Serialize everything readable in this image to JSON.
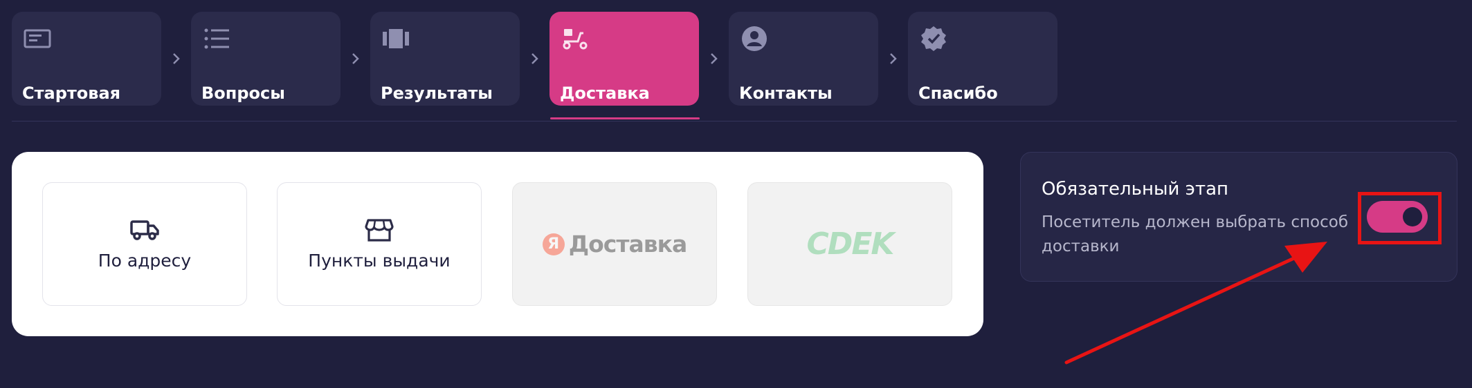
{
  "steps": [
    {
      "label": "Стартовая",
      "icon": "card-icon",
      "active": false
    },
    {
      "label": "Вопросы",
      "icon": "list-icon",
      "active": false
    },
    {
      "label": "Результаты",
      "icon": "slides-icon",
      "active": false
    },
    {
      "label": "Доставка",
      "icon": "scooter-icon",
      "active": true
    },
    {
      "label": "Контакты",
      "icon": "user-circle-icon",
      "active": false
    },
    {
      "label": "Спасибо",
      "icon": "verified-badge-icon",
      "active": false
    }
  ],
  "options": [
    {
      "label": "По адресу",
      "icon": "truck-icon",
      "disabled": false
    },
    {
      "label": "Пункты выдачи",
      "icon": "store-icon",
      "disabled": false
    },
    {
      "label": "Доставка",
      "logo_letter": "Я",
      "logo": "yandex-delivery-logo",
      "disabled": true
    },
    {
      "label": "CDEK",
      "logo": "cdek-logo",
      "disabled": true
    }
  ],
  "required_stage": {
    "title": "Обязательный этап",
    "description": "Посетитель должен выбрать способ доставки",
    "toggle_on": true
  },
  "colors": {
    "background": "#1f1f3d",
    "card": "#2b2b4b",
    "accent": "#d63b86",
    "annotation": "#e81414"
  }
}
